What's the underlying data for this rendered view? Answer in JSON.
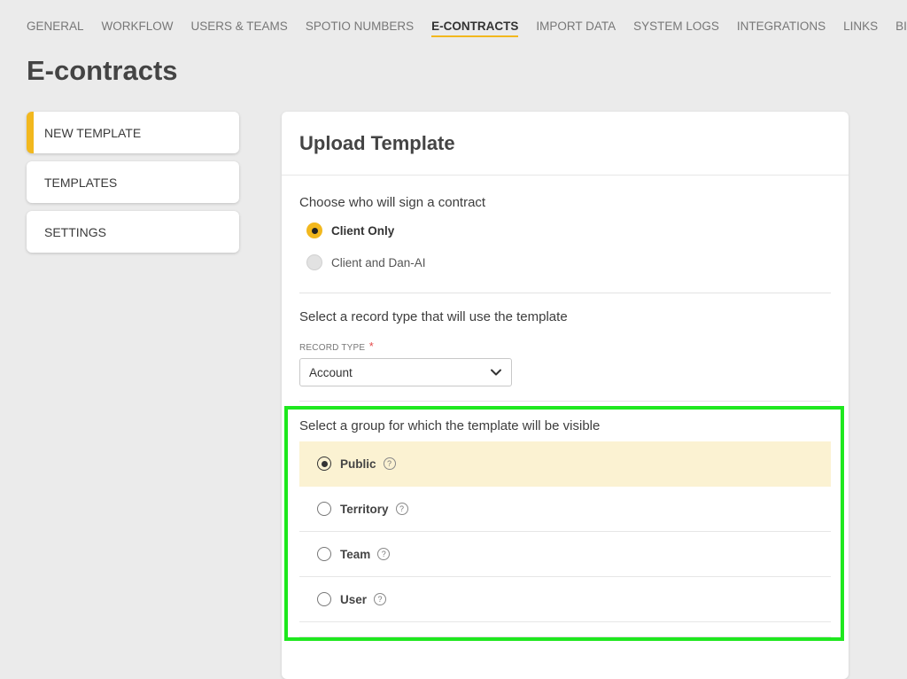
{
  "nav": {
    "items": [
      {
        "label": "GENERAL"
      },
      {
        "label": "WORKFLOW"
      },
      {
        "label": "USERS & TEAMS"
      },
      {
        "label": "SPOTIO NUMBERS"
      },
      {
        "label": "E-CONTRACTS"
      },
      {
        "label": "IMPORT DATA"
      },
      {
        "label": "SYSTEM LOGS"
      },
      {
        "label": "INTEGRATIONS"
      },
      {
        "label": "LINKS"
      },
      {
        "label": "BILLING"
      }
    ],
    "active": "E-CONTRACTS"
  },
  "page": {
    "title": "E-contracts"
  },
  "sidebar": {
    "items": [
      {
        "label": "NEW TEMPLATE"
      },
      {
        "label": "TEMPLATES"
      },
      {
        "label": "SETTINGS"
      }
    ]
  },
  "card": {
    "title": "Upload Template",
    "signers": {
      "title": "Choose who will sign a contract",
      "options": [
        {
          "label": "Client Only"
        },
        {
          "label": "Client and Dan-AI"
        }
      ],
      "selected": "Client Only"
    },
    "record": {
      "title": "Select a record type that will use the template",
      "field_label": "RECORD TYPE",
      "required_mark": "*",
      "value": "Account"
    },
    "group": {
      "title": "Select a group for which the template will be visible",
      "help_glyph": "?",
      "options": [
        {
          "label": "Public"
        },
        {
          "label": "Territory"
        },
        {
          "label": "Team"
        },
        {
          "label": "User"
        }
      ],
      "selected": "Public"
    }
  },
  "colors": {
    "accent": "#f2b81e",
    "highlight_border": "#1ee81e",
    "selected_row_bg": "#fbf2d2",
    "page_bg": "#ebebeb"
  }
}
